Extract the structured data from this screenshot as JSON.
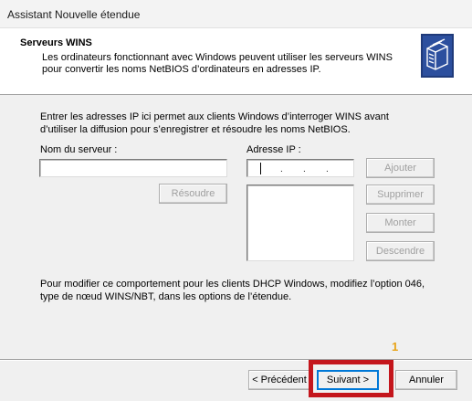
{
  "window": {
    "title": "Assistant Nouvelle étendue"
  },
  "header": {
    "title": "Serveurs WINS",
    "description": "Les ordinateurs fonctionnant avec Windows peuvent utiliser les serveurs WINS pour convertir les noms NetBIOS d’ordinateurs en adresses IP.",
    "icon": "wins-server-icon"
  },
  "intro": "Entrer les adresses IP ici permet aux clients Windows d’interroger WINS avant d’utiliser la diffusion pour s’enregistrer et résoudre les noms NetBIOS.",
  "server_name": {
    "label": "Nom du serveur :",
    "value": ""
  },
  "ip_address": {
    "label": "Adresse IP :",
    "value": ". . ."
  },
  "buttons": {
    "resolve": "Résoudre",
    "add": "Ajouter",
    "remove": "Supprimer",
    "up": "Monter",
    "down": "Descendre"
  },
  "ip_list": [],
  "footer_note": "Pour modifier ce comportement pour les clients DHCP Windows, modifiez l’option 046, type de nœud WINS/NBT, dans les options de l’étendue.",
  "nav": {
    "back": "< Précédent",
    "next": "Suivant >",
    "cancel": "Annuler"
  },
  "annotation": {
    "step": "1",
    "color": "#c4161c",
    "badge_color": "#e8a317"
  }
}
